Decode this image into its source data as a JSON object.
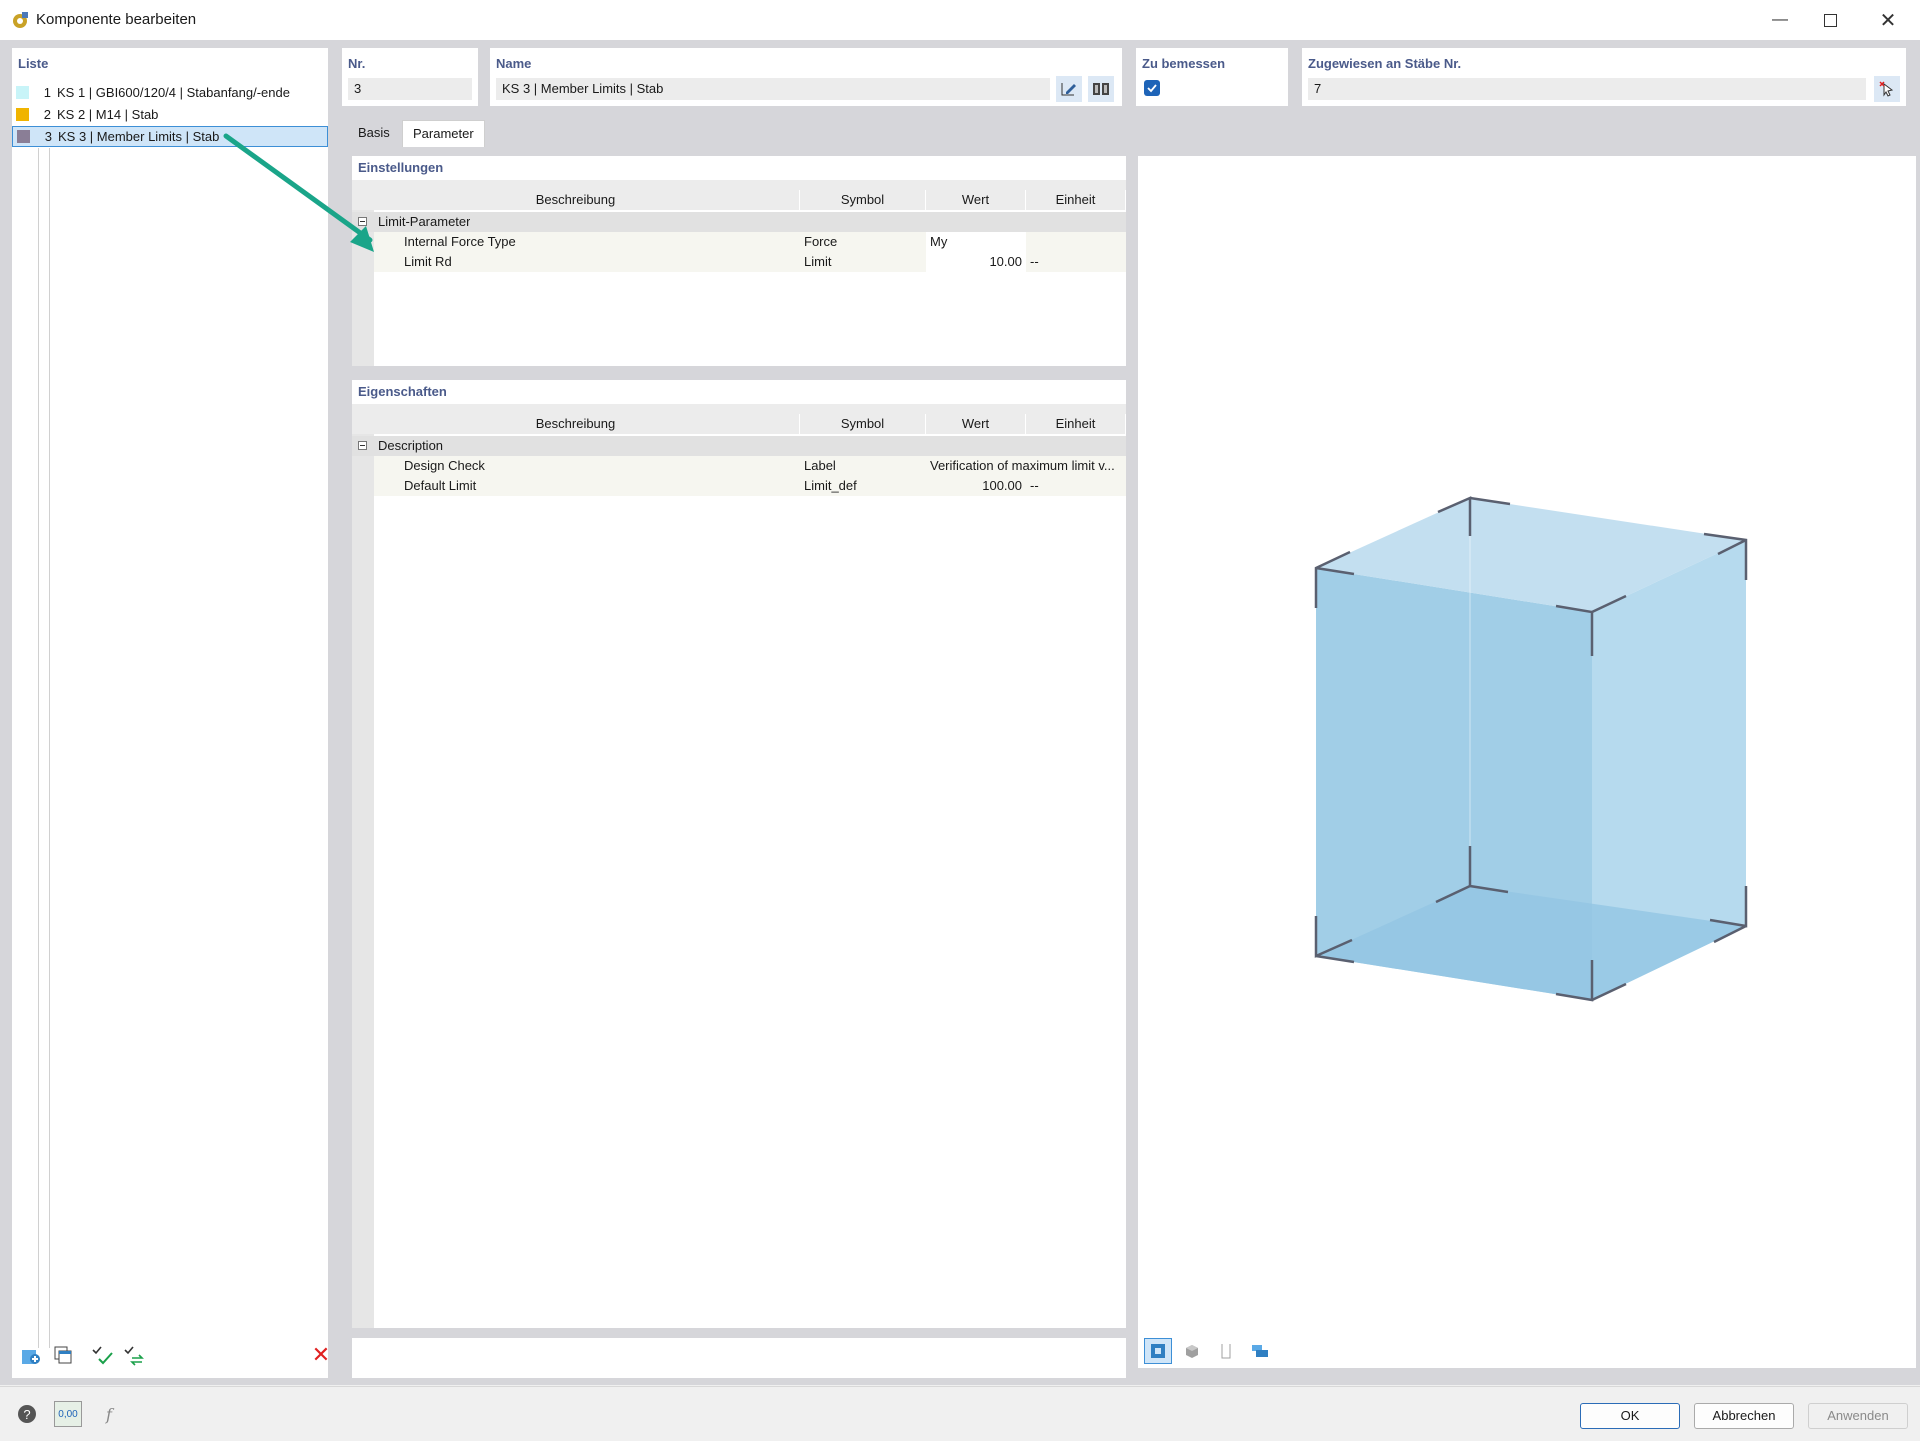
{
  "window": {
    "title": "Komponente bearbeiten"
  },
  "list": {
    "label": "Liste",
    "items": [
      {
        "num": "1",
        "text": "KS 1 | GBI600/120/4 | Stabanfang/-ende",
        "color": "#c8f4f8"
      },
      {
        "num": "2",
        "text": "KS 2 | M14 | Stab",
        "color": "#f0b400"
      },
      {
        "num": "3",
        "text": "KS 3 | Member Limits | Stab",
        "color": "#8a7e96"
      }
    ]
  },
  "header": {
    "nr_label": "Nr.",
    "nr_value": "3",
    "name_label": "Name",
    "name_value": "KS 3 | Member Limits | Stab",
    "design_label": "Zu bemessen",
    "assigned_label": "Zugewiesen an Stäbe Nr.",
    "assigned_value": "7"
  },
  "tabs": [
    {
      "label": "Basis"
    },
    {
      "label": "Parameter"
    }
  ],
  "settings": {
    "title": "Einstellungen",
    "columns": [
      "Beschreibung",
      "Symbol",
      "Wert",
      "Einheit"
    ],
    "group": "Limit-Parameter",
    "rows": [
      {
        "desc": "Internal Force Type",
        "symbol": "Force",
        "value": "My",
        "unit": ""
      },
      {
        "desc": "Limit Rd",
        "symbol": "Limit",
        "value": "10.00",
        "unit": "--"
      }
    ]
  },
  "properties": {
    "title": "Eigenschaften",
    "columns": [
      "Beschreibung",
      "Symbol",
      "Wert",
      "Einheit"
    ],
    "group": "Description",
    "rows": [
      {
        "desc": "Design Check",
        "symbol": "Label",
        "value": "Verification of maximum limit v...",
        "unit": ""
      },
      {
        "desc": "Default Limit",
        "symbol": "Limit_def",
        "value": "100.00",
        "unit": "--"
      }
    ]
  },
  "footer": {
    "ok": "OK",
    "cancel": "Abbrechen",
    "apply": "Anwenden",
    "num_icon_text": "0,00"
  },
  "colors": {
    "accent": "#1e64b8",
    "arrow": "#1aa589",
    "box_fill": "#9ccbe6",
    "box_edge": "#5a6070"
  }
}
